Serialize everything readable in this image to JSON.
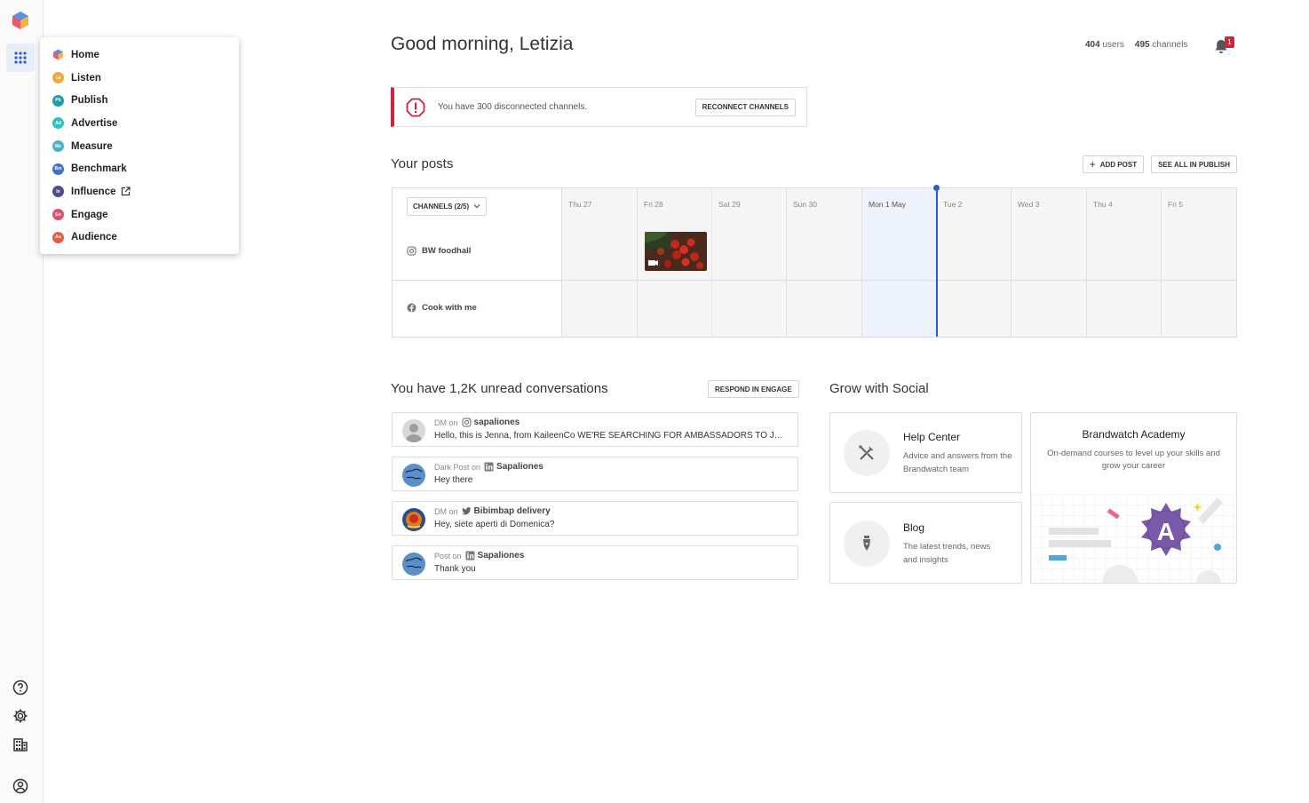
{
  "app": {
    "greeting": "Good morning, Letizia",
    "users_count": "404",
    "users_label": "users",
    "channels_count": "495",
    "channels_label": "channels",
    "notification_count": "1"
  },
  "product_menu": {
    "items": [
      {
        "label": "Home",
        "badge": "",
        "color": "#5a8fe0"
      },
      {
        "label": "Listen",
        "badge": "Le",
        "color": "#f2a93b"
      },
      {
        "label": "Publish",
        "badge": "Pb",
        "color": "#1a9fa8"
      },
      {
        "label": "Advertise",
        "badge": "Ad",
        "color": "#2cc2c2"
      },
      {
        "label": "Measure",
        "badge": "Me",
        "color": "#4bb0c8"
      },
      {
        "label": "Benchmark",
        "badge": "Bm",
        "color": "#3b6fd0"
      },
      {
        "label": "Influence",
        "badge": "In",
        "color": "#4a4f8c"
      },
      {
        "label": "Engage",
        "badge": "En",
        "color": "#e0506a"
      },
      {
        "label": "Audience",
        "badge": "Au",
        "color": "#ec5a42"
      }
    ]
  },
  "alert": {
    "text": "You have 300 disconnected channels.",
    "button": "RECONNECT CHANNELS"
  },
  "posts": {
    "title": "Your posts",
    "add_post": "ADD POST",
    "see_all": "SEE ALL IN PUBLISH",
    "channels_filter": "CHANNELS (2/5)",
    "channels": [
      {
        "name": "BW foodhall",
        "network": "instagram-icon"
      },
      {
        "name": "Cook with me",
        "network": "facebook-icon"
      }
    ],
    "days": [
      "Thu 27",
      "Fri 28",
      "Sat 29",
      "Sun 30",
      "Mon 1 May",
      "Tue 2",
      "Wed 3",
      "Thu 4",
      "Fri 5"
    ]
  },
  "conversations": {
    "title": "You have 1,2K unread conversations",
    "button": "RESPOND IN ENGAGE",
    "on_label": "on",
    "items": [
      {
        "type": "DM",
        "network": "instagram-icon",
        "author": "sapaliones",
        "message": "Hello, this is Jenna, from KaileenCo WE'RE SEARCHING FOR AMBASSADORS TO JOIN OUR TEAM"
      },
      {
        "type": "Dark Post",
        "network": "linkedin-icon",
        "author": "Sapaliones",
        "message": "Hey there"
      },
      {
        "type": "DM",
        "network": "twitter-icon",
        "author": "Bibimbap delivery",
        "message": "Hey, siete aperti di Domenica?"
      },
      {
        "type": "Post",
        "network": "linkedin-icon",
        "author": "Sapaliones",
        "message": "Thank you"
      }
    ]
  },
  "grow": {
    "title": "Grow with Social",
    "help_title": "Help Center",
    "help_desc": "Advice and answers from the Brandwatch team",
    "blog_title": "Blog",
    "blog_desc": "The latest trends, news and insights",
    "academy_title": "Brandwatch Academy",
    "academy_desc": "On-demand courses to level up your skills and grow your career",
    "academy_letter": "A"
  }
}
